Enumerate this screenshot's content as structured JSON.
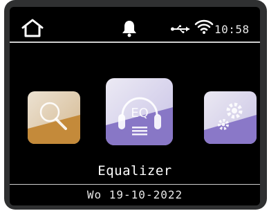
{
  "status_bar": {
    "time": "10:58",
    "icons": [
      "home-icon",
      "bell-icon",
      "usb-icon",
      "wifi-icon"
    ]
  },
  "carousel": {
    "apps": [
      {
        "name": "search",
        "icon": "search-icon",
        "selected": false
      },
      {
        "name": "equalizer",
        "icon": "equalizer-icon",
        "badge_text": "EQ",
        "selected": true
      },
      {
        "name": "settings",
        "icon": "gears-icon",
        "selected": false
      }
    ],
    "selected_label": "Equalizer"
  },
  "footer": {
    "date": "Wo 19-10-2022"
  },
  "colors": {
    "accent_purple": "#8a78c8",
    "accent_orange": "#c08a3a",
    "screen_bg": "#000000"
  }
}
